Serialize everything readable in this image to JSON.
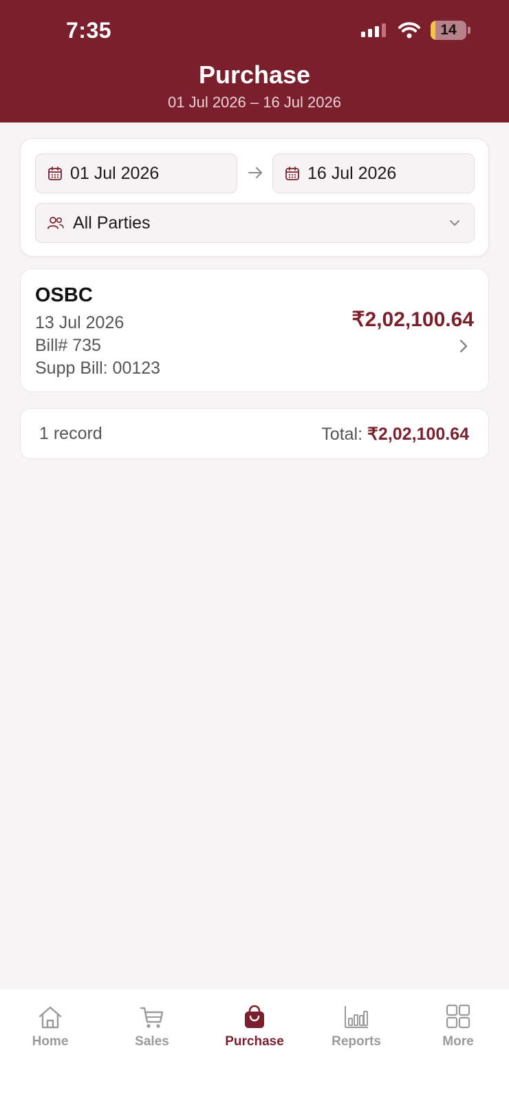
{
  "status_bar": {
    "time": "7:35",
    "battery": "14",
    "battery_level": 0.14
  },
  "header": {
    "title": "Purchase",
    "subtitle": "01 Jul 2026 – 16 Jul 2026"
  },
  "filters": {
    "from_date": "01 Jul 2026",
    "to_date": "16 Jul 2026",
    "party": "All Parties"
  },
  "purchases": [
    {
      "party": "OSBC",
      "date": "13 Jul 2026",
      "bill": "Bill# 735",
      "supp_bill": "Supp Bill: 00123",
      "amount": "₹2,02,100.64"
    }
  ],
  "summary": {
    "record_count": "1 record",
    "total_label": "Total:",
    "total_amount": "₹2,02,100.64"
  },
  "tabs": [
    {
      "label": "Home",
      "icon": "home-icon"
    },
    {
      "label": "Sales",
      "icon": "cart-icon"
    },
    {
      "label": "Purchase",
      "icon": "shopping-bag-icon",
      "active": true
    },
    {
      "label": "Reports",
      "icon": "bar-chart-icon"
    },
    {
      "label": "More",
      "icon": "grid-icon"
    }
  ],
  "colors": {
    "brand": "#7b1f2c",
    "background": "#f8f3f4",
    "muted": "#9a9a9a"
  }
}
